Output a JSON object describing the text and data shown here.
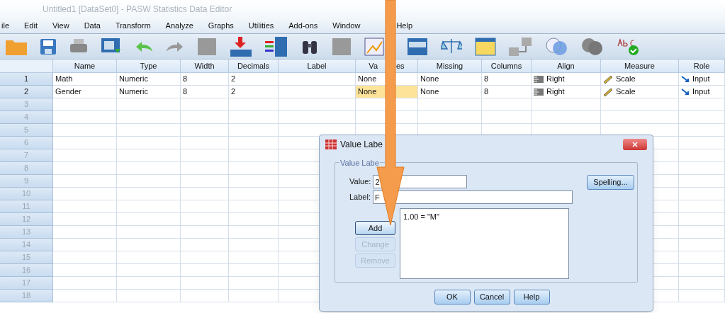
{
  "window": {
    "title": "Untitled1 [DataSet0] - PASW Statistics Data Editor"
  },
  "menu": [
    "ile",
    "Edit",
    "View",
    "Data",
    "Transform",
    "Analyze",
    "Graphs",
    "Utilities",
    "Add-ons",
    "Window",
    "Help"
  ],
  "table": {
    "columns": [
      {
        "label": "Name",
        "kind": "text"
      },
      {
        "label": "Type",
        "kind": "text"
      },
      {
        "label": "Width",
        "kind": "text"
      },
      {
        "label": "Decimals",
        "kind": "text"
      },
      {
        "label": "Label",
        "kind": "text"
      },
      {
        "label": "Va",
        "label_end": "es",
        "kind": "text"
      },
      {
        "label": "Missing",
        "kind": "text"
      },
      {
        "label": "Columns",
        "kind": "text"
      },
      {
        "label": "Align",
        "kind": "align"
      },
      {
        "label": "Measure",
        "kind": "measure"
      },
      {
        "label": "Role",
        "kind": "role"
      }
    ],
    "rows": [
      {
        "number": "1",
        "cells": [
          {
            "text": "Math",
            "selected": false
          },
          {
            "text": "Numeric",
            "selected": false
          },
          {
            "text": "8",
            "selected": false
          },
          {
            "text": "2",
            "selected": false
          },
          {
            "selected": false
          },
          {
            "text": "None",
            "selected": false
          },
          {
            "text": "None",
            "selected": false
          },
          {
            "text": "8",
            "selected": false
          },
          {
            "text": "Right",
            "selected": false
          },
          {
            "text": "Scale",
            "selected": false
          },
          {
            "text": "Input",
            "selected": false
          }
        ]
      },
      {
        "number": "2",
        "cells": [
          {
            "text": "Gender",
            "selected": false
          },
          {
            "text": "Numeric",
            "selected": false
          },
          {
            "text": "8",
            "selected": false
          },
          {
            "text": "2",
            "selected": false
          },
          {
            "selected": false
          },
          {
            "text": "None",
            "selected": true
          },
          {
            "text": "None",
            "selected": false
          },
          {
            "text": "8",
            "selected": false
          },
          {
            "text": "Right",
            "selected": false
          },
          {
            "text": "Scale",
            "selected": false
          },
          {
            "text": "Input",
            "selected": false
          }
        ]
      },
      {
        "number": "3"
      },
      {
        "number": "4"
      },
      {
        "number": "5"
      },
      {
        "number": "6"
      },
      {
        "number": "7"
      },
      {
        "number": "8"
      },
      {
        "number": "9"
      },
      {
        "number": "10"
      },
      {
        "number": "11"
      },
      {
        "number": "12"
      },
      {
        "number": "13"
      },
      {
        "number": "14"
      },
      {
        "number": "15"
      },
      {
        "number": "16"
      },
      {
        "number": "17"
      },
      {
        "number": "18"
      }
    ]
  },
  "dialog": {
    "title": "Value Labe",
    "group": "Value Labe",
    "value_label": "Value:",
    "value": "2",
    "label_label": "Label:",
    "label": "F",
    "list": [
      "1.00 = \"M\""
    ],
    "side_buttons": [
      {
        "label": "Add",
        "disabled": false
      },
      {
        "label": "Change",
        "disabled": true
      },
      {
        "label": "Remove",
        "disabled": true
      }
    ],
    "spelling": "Spelling...",
    "buttons": [
      "OK",
      "Cancel",
      "Help"
    ]
  }
}
